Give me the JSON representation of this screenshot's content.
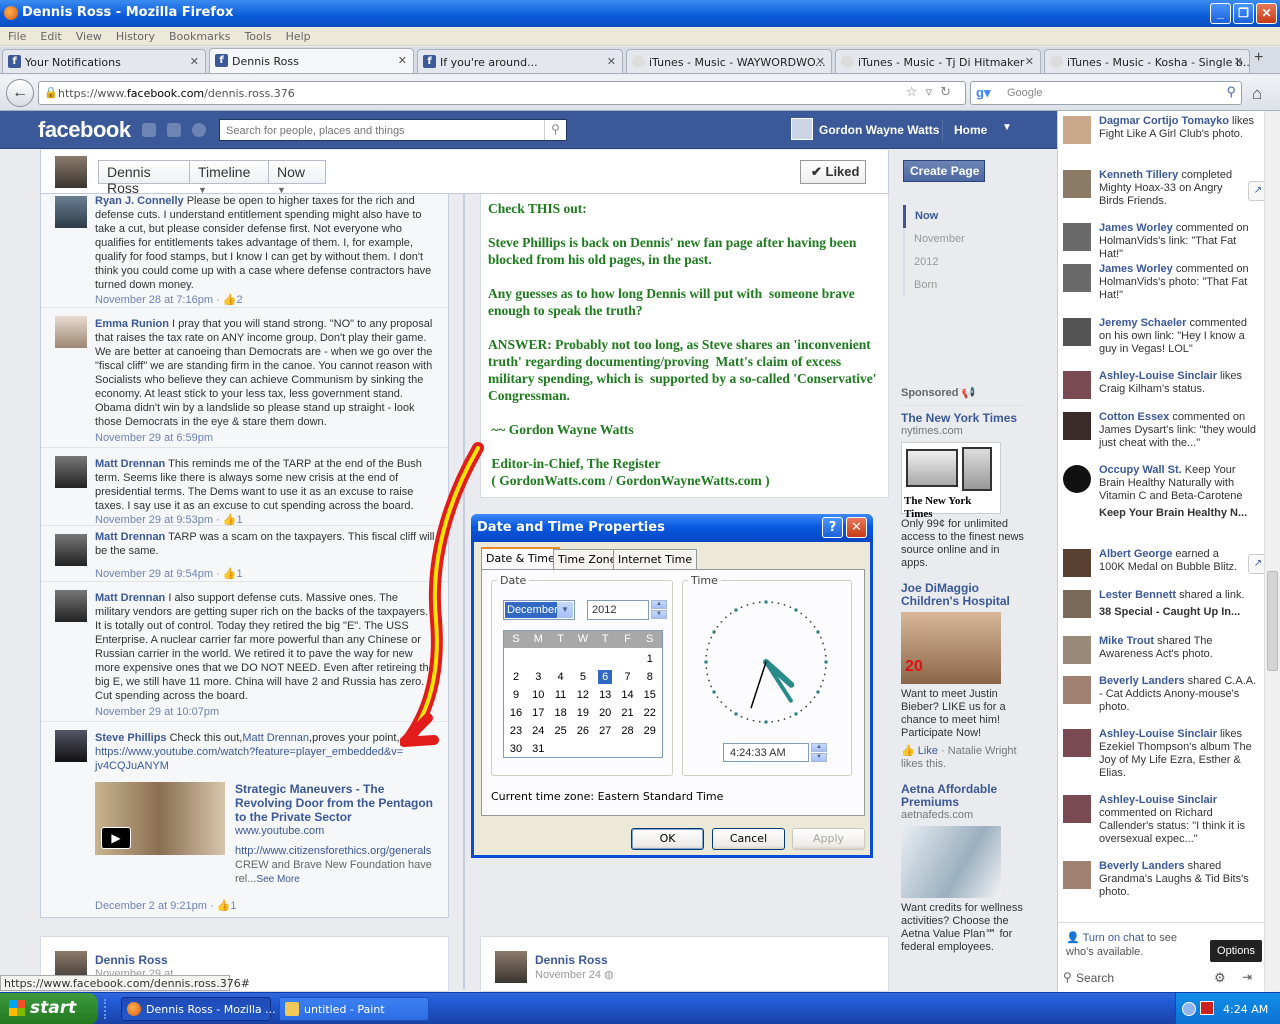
{
  "window": {
    "title": "Dennis Ross - Mozilla Firefox"
  },
  "menu": [
    "File",
    "Edit",
    "View",
    "History",
    "Bookmarks",
    "Tools",
    "Help"
  ],
  "tabs": [
    {
      "label": "Your Notifications",
      "icon": "facebook-icon"
    },
    {
      "label": "Dennis Ross",
      "icon": "facebook-icon",
      "active": true
    },
    {
      "label": "If you're around...",
      "icon": "facebook-icon"
    },
    {
      "label": "iTunes - Music - WAYWORDWO...",
      "icon": "apple-icon"
    },
    {
      "label": "iTunes - Music - Tj Di Hitmaker",
      "icon": "apple-icon"
    },
    {
      "label": "iTunes - Music - Kosha - Single b...",
      "icon": "apple-icon"
    }
  ],
  "nav": {
    "url_prefix": "https://www.",
    "url_domain": "facebook.com",
    "url_path": "/dennis.ross.376",
    "search_placeholder": "Google"
  },
  "fb": {
    "logo": "facebook",
    "search_placeholder": "Search for people, places and things",
    "user": "Gordon Wayne Watts",
    "home": "Home"
  },
  "timeline": {
    "page": "Dennis Ross",
    "section": "Timeline",
    "when": "Now",
    "liked": "✔ Liked"
  },
  "comments": [
    {
      "name": "Ryan J. Connelly",
      "text": " Please be open to higher taxes for the rich and defense cuts. I understand entitlement spending might also have to take a cut, but please consider defense first. Not everyone who qualifies for entitlements takes advantage of them. I, for example, qualify for food stamps, but I know I can get by without them. I don't think you could come up with a case where defense contractors have turned down money.",
      "meta": "November 28 at 7:16pm · ",
      "likes": "2"
    },
    {
      "name": "Emma Runion",
      "text": " I pray that you will stand strong. \"NO\" to any proposal that raises the tax rate on ANY income group. Don't play their game. We are better at canoeing than Democrats are - when we go over the \"fiscal cliff\" we are standing firm in the canoe. You cannot reason with Socialists who believe they can achieve Communism by sinking the economy. At least stick to your less tax, less government stand. Obama didn't win by a landslide so please stand up straight - look those Democrats in the eye & stare them down.",
      "meta": "November 29 at 6:59pm",
      "likes": ""
    },
    {
      "name": "Matt Drennan",
      "text": " This reminds me of the TARP at the end of the Bush term. Seems like there is always some new crisis at the end of presidential terms. The Dems want to use it as an excuse to raise taxes. I say use it as an excuse to cut spending across the board.",
      "meta": "November 29 at 9:53pm · ",
      "likes": "1"
    },
    {
      "name": "Matt Drennan",
      "text": " TARP was a scam on the taxpayers. This fiscal cliff will be the same.",
      "meta": "November 29 at 9:54pm · ",
      "likes": "1"
    },
    {
      "name": "Matt Drennan",
      "text": " I also support defense cuts. Massive ones. The military vendors are getting super rich on the backs of the taxpayers. It is totally out of control. Today they retired the big \"E\". The USS Enterprise. A nuclear carrier far more powerful than any Chinese or Russian carrier in the world. We retired it to pave the way for new more expensive ones that we DO NOT NEED. Even after retireing the big E, we still have 11 more. China will have 2 and Russia has zero. Cut spending across the board.",
      "meta": "November 29 at 10:07pm",
      "likes": ""
    }
  ],
  "steve": {
    "name": "Steve Phillips",
    "text1": " Check this out,",
    "mention": "Matt Drennan",
    "text2": ",proves your point,",
    "url": "https://www.youtube.com/watch?feature=player_embedded&v=jv4CQJuANYM",
    "link_title": "Strategic Maneuvers - The Revolving Door from the Pentagon to the Private Sector",
    "link_domain": "www.youtube.com",
    "link_url": "http://www.citizensforethics.org/generals",
    "link_desc": " CREW and Brave New Foundation have rel...",
    "see_more": "See More",
    "meta": "December 2 at 9:21pm · ",
    "likes": "1"
  },
  "post": {
    "text": "Check THIS out:\n\nSteve Phillips is back on Dennis' new fan page after having been blocked from his old pages, in the past.\n\nAny guesses as to how long Dennis will put with  someone brave enough to speak the truth?\n\nANSWER: Probably not too long, as Steve shares an 'inconvenient truth' regarding documenting/proving  Matt's claim of excess military spending, which is  supported by a so-called 'Conservative'  Congressman.\n\n ~~ Gordon Wayne Watts\n\n Editor-in-Chief, The Register\n ( GordonWatts.com / GordonWayneWatts.com )"
  },
  "tlnav": {
    "create_page": "Create Page",
    "items": [
      "Now",
      "November",
      "2012",
      "Born"
    ]
  },
  "sponsored": {
    "heading": "Sponsored",
    "ads": [
      {
        "title": "The New York Times",
        "domain": "nytimes.com",
        "text": "Only 99¢ for unlimited access to the finest news source online and in apps.",
        "pic_text": "The New York Times"
      },
      {
        "title": "Joe DiMaggio Children's Hospital",
        "domain": "",
        "text": "Want to meet Justin Bieber? LIKE us for a chance to meet him! Participate Now!",
        "like": "Like",
        "like_by": " · Natalie Wright likes this."
      },
      {
        "title": "Aetna Affordable Premiums",
        "domain": "aetnafeds.com",
        "text": "Want credits for wellness activities? Choose the Aetna Value Plan℠ for federal employees."
      }
    ]
  },
  "ticker": [
    {
      "name": "Dagmar Cortijo Tomayko",
      "text": " likes Fight Like A Girl Club's photo."
    },
    {
      "name": "Kenneth Tillery",
      "text": " completed Mighty Hoax-33 on Angry Birds Friends.",
      "share": true
    },
    {
      "name": "James Worley",
      "text": " commented on HolmanVids's link: \"That Fat Hat!\""
    },
    {
      "name": "James Worley",
      "text": " commented on HolmanVids's photo: \"That Fat Hat!\""
    },
    {
      "name": "Jeremy Schaeler",
      "text": " commented on his own link: \"Hey I know a guy in Vegas! LOL\""
    },
    {
      "name": "Ashley-Louise Sinclair",
      "text": " likes Craig Kilham's status."
    },
    {
      "name": "Cotton Essex",
      "text": " commented on James Dysart's link: \"they would just cheat with the...\""
    },
    {
      "name": "Occupy Wall St.",
      "text": " Keep Your Brain Healthy Naturally with Vitamin C and Beta-Carotene",
      "sub": "Keep Your Brain Healthy N..."
    },
    {
      "name": "Albert George",
      "text": " earned a 100K Medal on Bubble Blitz.",
      "share": true
    },
    {
      "name": "Lester Bennett",
      "text": " shared a link.",
      "sub": "38 Special - Caught Up In..."
    },
    {
      "name": "Mike Trout",
      "text": " shared The Awareness Act's photo."
    },
    {
      "name": "Beverly Landers",
      "text": " shared C.A.A. - Cat Addicts Anony-mouse's photo."
    },
    {
      "name": "Ashley-Louise Sinclair",
      "text": " likes Ezekiel Thompson's album The Joy of My Life Ezra, Esther & Elias."
    },
    {
      "name": "Ashley-Louise Sinclair",
      "text": " commented on Richard Callender's status: \"I think it is oversexual expec...\""
    },
    {
      "name": "Beverly Landers",
      "text": " shared Grandma's Laughs & Tid Bits's photo."
    }
  ],
  "chat": {
    "turn_on": "Turn on chat",
    "turn_on_rest": " to see who's available.",
    "search": "Search",
    "options": "Options"
  },
  "bottom": {
    "left_name": "Dennis Ross",
    "left_meta": "November 29 at ...",
    "right_name": "Dennis Ross",
    "right_meta": "November 24"
  },
  "dialog": {
    "title": "Date and Time Properties",
    "tabs": [
      "Date & Time",
      "Time Zone",
      "Internet Time"
    ],
    "date_label": "Date",
    "time_label": "Time",
    "month": "December",
    "year": "2012",
    "weekdays": [
      "S",
      "M",
      "T",
      "W",
      "T",
      "F",
      "S"
    ],
    "selected_day": 6,
    "time": "4:24:33 AM",
    "timezone": "Current time zone:  Eastern Standard Time",
    "ok": "OK",
    "cancel": "Cancel",
    "apply": "Apply"
  },
  "status_url": "https://www.facebook.com/dennis.ross.376#",
  "taskbar": {
    "start": "start",
    "tasks": [
      "Dennis Ross - Mozilla ...",
      "untitled - Paint"
    ],
    "clock": "4:24 AM"
  }
}
